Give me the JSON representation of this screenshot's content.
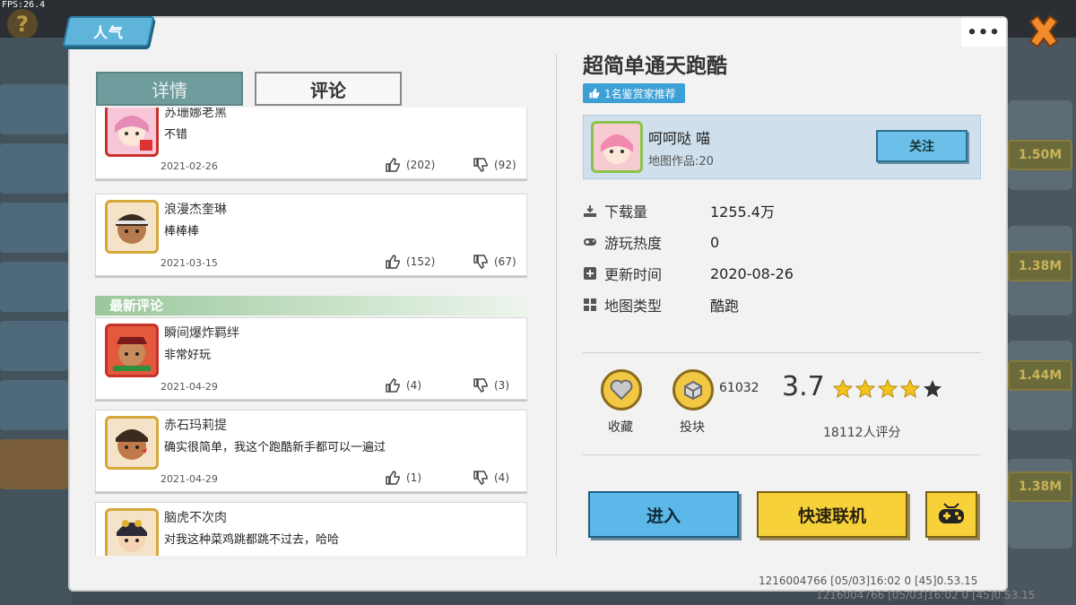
{
  "fps": "FPS:26.4",
  "header": {
    "tag": "人气",
    "more": "•••"
  },
  "tabs": {
    "detail": "详情",
    "comment": "评论"
  },
  "comments": [
    {
      "name": "苏珊娜老黑",
      "text": "不错",
      "date": "2021-02-26",
      "likes": "(202)",
      "dislikes": "(92)"
    },
    {
      "name": "浪漫杰奎琳",
      "text": "棒棒棒",
      "date": "2021-03-15",
      "likes": "(152)",
      "dislikes": "(67)"
    }
  ],
  "latest_label": "最新评论",
  "latest_comments": [
    {
      "name": "瞬间爆炸羁绊",
      "text": "非常好玩",
      "date": "2021-04-29",
      "likes": "(4)",
      "dislikes": "(3)"
    },
    {
      "name": "赤石玛莉提",
      "text": "确实很简单，我这个跑酷新手都可以一遍过",
      "date": "2021-04-29",
      "likes": "(1)",
      "dislikes": "(4)"
    },
    {
      "name": "脑虎不次肉",
      "text": "对我这种菜鸡跳都跳不过去，哈哈",
      "date": "",
      "likes": "",
      "dislikes": ""
    }
  ],
  "map": {
    "title": "超简单通天跑酷",
    "recommend": "1名鉴赏家推荐",
    "author": {
      "name": "呵呵哒  喵",
      "works": "地图作品:20",
      "follow": "关注"
    },
    "info": [
      {
        "label": "下载量",
        "value": "1255.4万"
      },
      {
        "label": "游玩热度",
        "value": "0"
      },
      {
        "label": "更新时间",
        "value": "2020-08-26"
      },
      {
        "label": "地图类型",
        "value": "酷跑"
      }
    ],
    "favorite_label": "收藏",
    "block_label": "投块",
    "block_count": "61032",
    "score": "3.7",
    "stars": 3.7,
    "rating_count": "18112人评分"
  },
  "actions": {
    "enter": "进入",
    "quick": "快速联机"
  },
  "footer": "1216004766   [05/03]16:02 0   [45]0.53.15",
  "bg_side_tags": [
    "1.50M",
    "1.38M",
    "1.44M",
    "1.38M"
  ],
  "colors": {
    "blue_button": "#5bb8e8",
    "yellow_button": "#f6d13a",
    "accent_tag": "#5fb4d9"
  }
}
